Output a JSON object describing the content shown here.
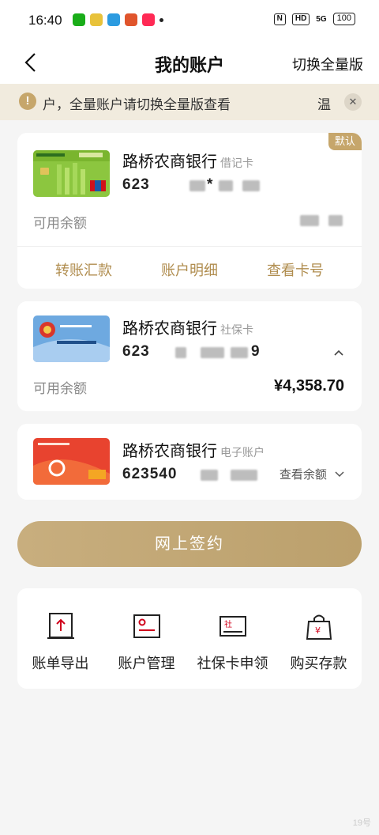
{
  "status_bar": {
    "time": "16:40",
    "battery": "100",
    "net": "5G",
    "hd": "HD"
  },
  "header": {
    "title": "我的账户",
    "switch_label": "切换全量版"
  },
  "notice": {
    "text": "户，全量账户请切换全量版查看",
    "tail": "温"
  },
  "cards": [
    {
      "bank": "路桥农商银行",
      "type": "借记卡",
      "number_prefix": "623",
      "number_mid": "*",
      "tag": "默认",
      "balance_label": "可用余额",
      "actions": [
        "转账汇款",
        "账户明细",
        "查看卡号"
      ]
    },
    {
      "bank": "路桥农商银行",
      "type": "社保卡",
      "number_prefix": "623",
      "number_suffix": "9",
      "balance_label": "可用余额",
      "balance": "¥4,358.70"
    },
    {
      "bank": "路桥农商银行",
      "type": "电子账户",
      "number_prefix": "623540",
      "view_balance": "查看余额"
    }
  ],
  "sign_button": "网上签约",
  "tools": [
    {
      "label": "账单导出",
      "icon": "export-icon"
    },
    {
      "label": "账户管理",
      "icon": "account-manage-icon"
    },
    {
      "label": "社保卡申领",
      "icon": "social-card-icon"
    },
    {
      "label": "购买存款",
      "icon": "shopping-bag-icon"
    }
  ],
  "watermark": "19号",
  "colors": {
    "gold": "#c6a66b",
    "gold_text": "#b08d4f",
    "red_icon": "#d0021b"
  }
}
